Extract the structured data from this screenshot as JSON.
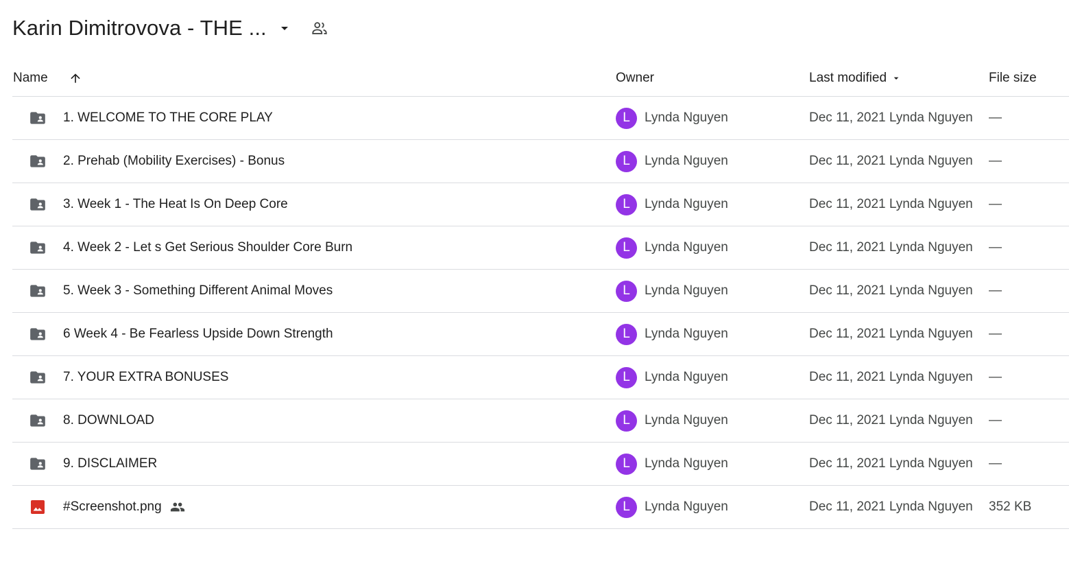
{
  "header": {
    "title": "Karin Dimitrovova - THE ...",
    "dropdown_icon": "arrow-drop-down-icon",
    "shared_icon": "people-outline-icon"
  },
  "columns": {
    "name": "Name",
    "owner": "Owner",
    "last_modified": "Last modified",
    "file_size": "File size"
  },
  "colors": {
    "avatar": "#9334e6",
    "folder_icon": "#5f6368",
    "image_icon": "#d93025"
  },
  "files": [
    {
      "name": "1. WELCOME TO THE CORE PLAY",
      "type": "shared-folder",
      "owner_initial": "L",
      "owner": "Lynda Nguyen",
      "modified": "Dec 11, 2021 Lynda Nguyen",
      "size": "—"
    },
    {
      "name": "2. Prehab (Mobility Exercises) - Bonus",
      "type": "shared-folder",
      "owner_initial": "L",
      "owner": "Lynda Nguyen",
      "modified": "Dec 11, 2021 Lynda Nguyen",
      "size": "—"
    },
    {
      "name": "3. Week 1 - The Heat Is On Deep Core",
      "type": "shared-folder",
      "owner_initial": "L",
      "owner": "Lynda Nguyen",
      "modified": "Dec 11, 2021 Lynda Nguyen",
      "size": "—"
    },
    {
      "name": "4. Week 2 - Let s Get Serious Shoulder Core Burn",
      "type": "shared-folder",
      "owner_initial": "L",
      "owner": "Lynda Nguyen",
      "modified": "Dec 11, 2021 Lynda Nguyen",
      "size": "—"
    },
    {
      "name": "5. Week 3 - Something Different Animal Moves",
      "type": "shared-folder",
      "owner_initial": "L",
      "owner": "Lynda Nguyen",
      "modified": "Dec 11, 2021 Lynda Nguyen",
      "size": "—"
    },
    {
      "name": "6 Week 4 - Be Fearless Upside Down Strength",
      "type": "shared-folder",
      "owner_initial": "L",
      "owner": "Lynda Nguyen",
      "modified": "Dec 11, 2021 Lynda Nguyen",
      "size": "—"
    },
    {
      "name": "7. YOUR EXTRA BONUSES",
      "type": "shared-folder",
      "owner_initial": "L",
      "owner": "Lynda Nguyen",
      "modified": "Dec 11, 2021 Lynda Nguyen",
      "size": "—"
    },
    {
      "name": "8. DOWNLOAD",
      "type": "shared-folder",
      "owner_initial": "L",
      "owner": "Lynda Nguyen",
      "modified": "Dec 11, 2021 Lynda Nguyen",
      "size": "—"
    },
    {
      "name": "9. DISCLAIMER",
      "type": "shared-folder",
      "owner_initial": "L",
      "owner": "Lynda Nguyen",
      "modified": "Dec 11, 2021 Lynda Nguyen",
      "size": "—"
    },
    {
      "name": "#Screenshot.png",
      "type": "image",
      "shared": true,
      "owner_initial": "L",
      "owner": "Lynda Nguyen",
      "modified": "Dec 11, 2021 Lynda Nguyen",
      "size": "352 KB"
    }
  ]
}
